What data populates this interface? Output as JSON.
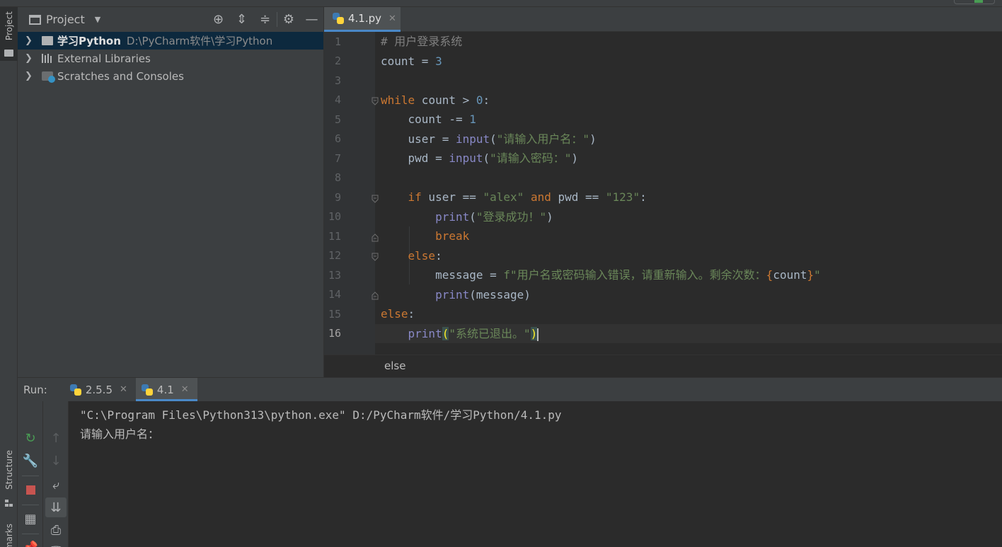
{
  "project_panel": {
    "title": "Project",
    "tree": [
      {
        "name": "学习Python",
        "path": "D:\\PyCharm软件\\学习Python"
      },
      {
        "name": "External Libraries"
      },
      {
        "name": "Scratches and Consoles"
      }
    ]
  },
  "side_tabs": {
    "project": "Project",
    "structure": "Structure",
    "bookmarks": "Bookmarks"
  },
  "editor": {
    "tab": "4.1.py",
    "line_numbers": [
      "1",
      "2",
      "3",
      "4",
      "5",
      "6",
      "7",
      "8",
      "9",
      "10",
      "11",
      "12",
      "13",
      "14",
      "15",
      "16"
    ],
    "current_line": "16",
    "breadcrumb": "else"
  },
  "code": {
    "l1_comment": "# 用户登录系统",
    "l2_var": "count",
    "l2_op": " = ",
    "l2_num": "3",
    "l4_kw": "while",
    "l4_rest": " count > ",
    "l4_num": "0",
    "l4_colon": ":",
    "l5_text": "    count -= ",
    "l5_num": "1",
    "l6_pre": "    user = ",
    "l6_fn": "input",
    "l6_open": "(",
    "l6_str": "\"请输入用户名：\"",
    "l6_close": ")",
    "l7_pre": "    pwd = ",
    "l7_fn": "input",
    "l7_open": "(",
    "l7_str": "\"请输入密码：\"",
    "l7_close": ")",
    "l9_indent": "    ",
    "l9_kw": "if",
    "l9_a": " user == ",
    "l9_s1": "\"alex\"",
    "l9_and": "and",
    "l9_b": " pwd == ",
    "l9_s2": "\"123\"",
    "l9_colon": ":",
    "l10_indent": "        ",
    "l10_fn": "print",
    "l10_open": "(",
    "l10_str": "\"登录成功！\"",
    "l10_close": ")",
    "l11_indent": "        ",
    "l11_kw": "break",
    "l12_indent": "    ",
    "l12_kw": "else",
    "l12_colon": ":",
    "l13_pre": "        message = ",
    "l13_str1": "f\"用户名或密码输入错误，请重新输入。剩余次数：",
    "l13_lb": "{",
    "l13_var": "count",
    "l13_rb": "}",
    "l13_str2": "\"",
    "l14_indent": "        ",
    "l14_fn": "print",
    "l14_rest": "(message)",
    "l15_kw": "else",
    "l15_colon": ":",
    "l16_indent": "    ",
    "l16_fn": "print",
    "l16_open": "(",
    "l16_str": "\"系统已退出。\"",
    "l16_close": ")"
  },
  "run": {
    "label": "Run:",
    "tabs": [
      "2.5.5",
      "4.1"
    ],
    "console": [
      "\"C:\\Program Files\\Python313\\python.exe\" D:/PyCharm软件/学习Python/4.1.py",
      "请输入用户名："
    ]
  },
  "colors": {
    "accent": "#4a88c7",
    "keyword": "#cc7832",
    "string": "#6a8759",
    "number": "#6897bb",
    "builtin": "#8888c6",
    "stop": "#c75450",
    "rerun": "#499c54"
  }
}
